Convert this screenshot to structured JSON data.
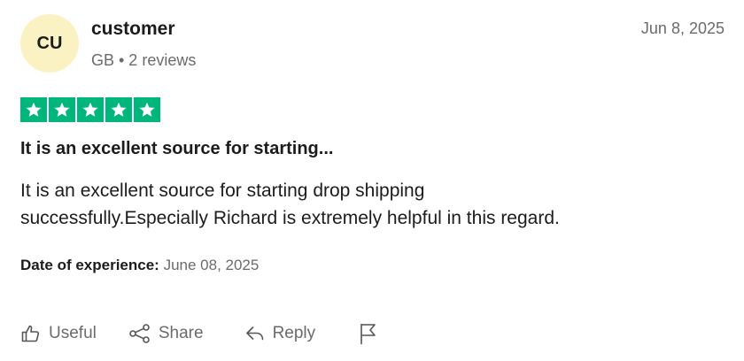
{
  "reviewer": {
    "initials": "CU",
    "name": "customer",
    "meta": "GB • 2 reviews"
  },
  "review": {
    "date": "Jun 8, 2025",
    "rating": 5,
    "star_color": "#00b67a",
    "title": "It is an excellent source for starting...",
    "body_line1": "It is an excellent source for starting drop shipping",
    "body_line2": "successfully.Especially Richard is extremely helpful in this regard.",
    "experience_label": "Date of experience:",
    "experience_date": "June 08, 2025"
  },
  "actions": {
    "useful": "Useful",
    "share": "Share",
    "reply": "Reply",
    "flag_icon": "flag-icon"
  }
}
